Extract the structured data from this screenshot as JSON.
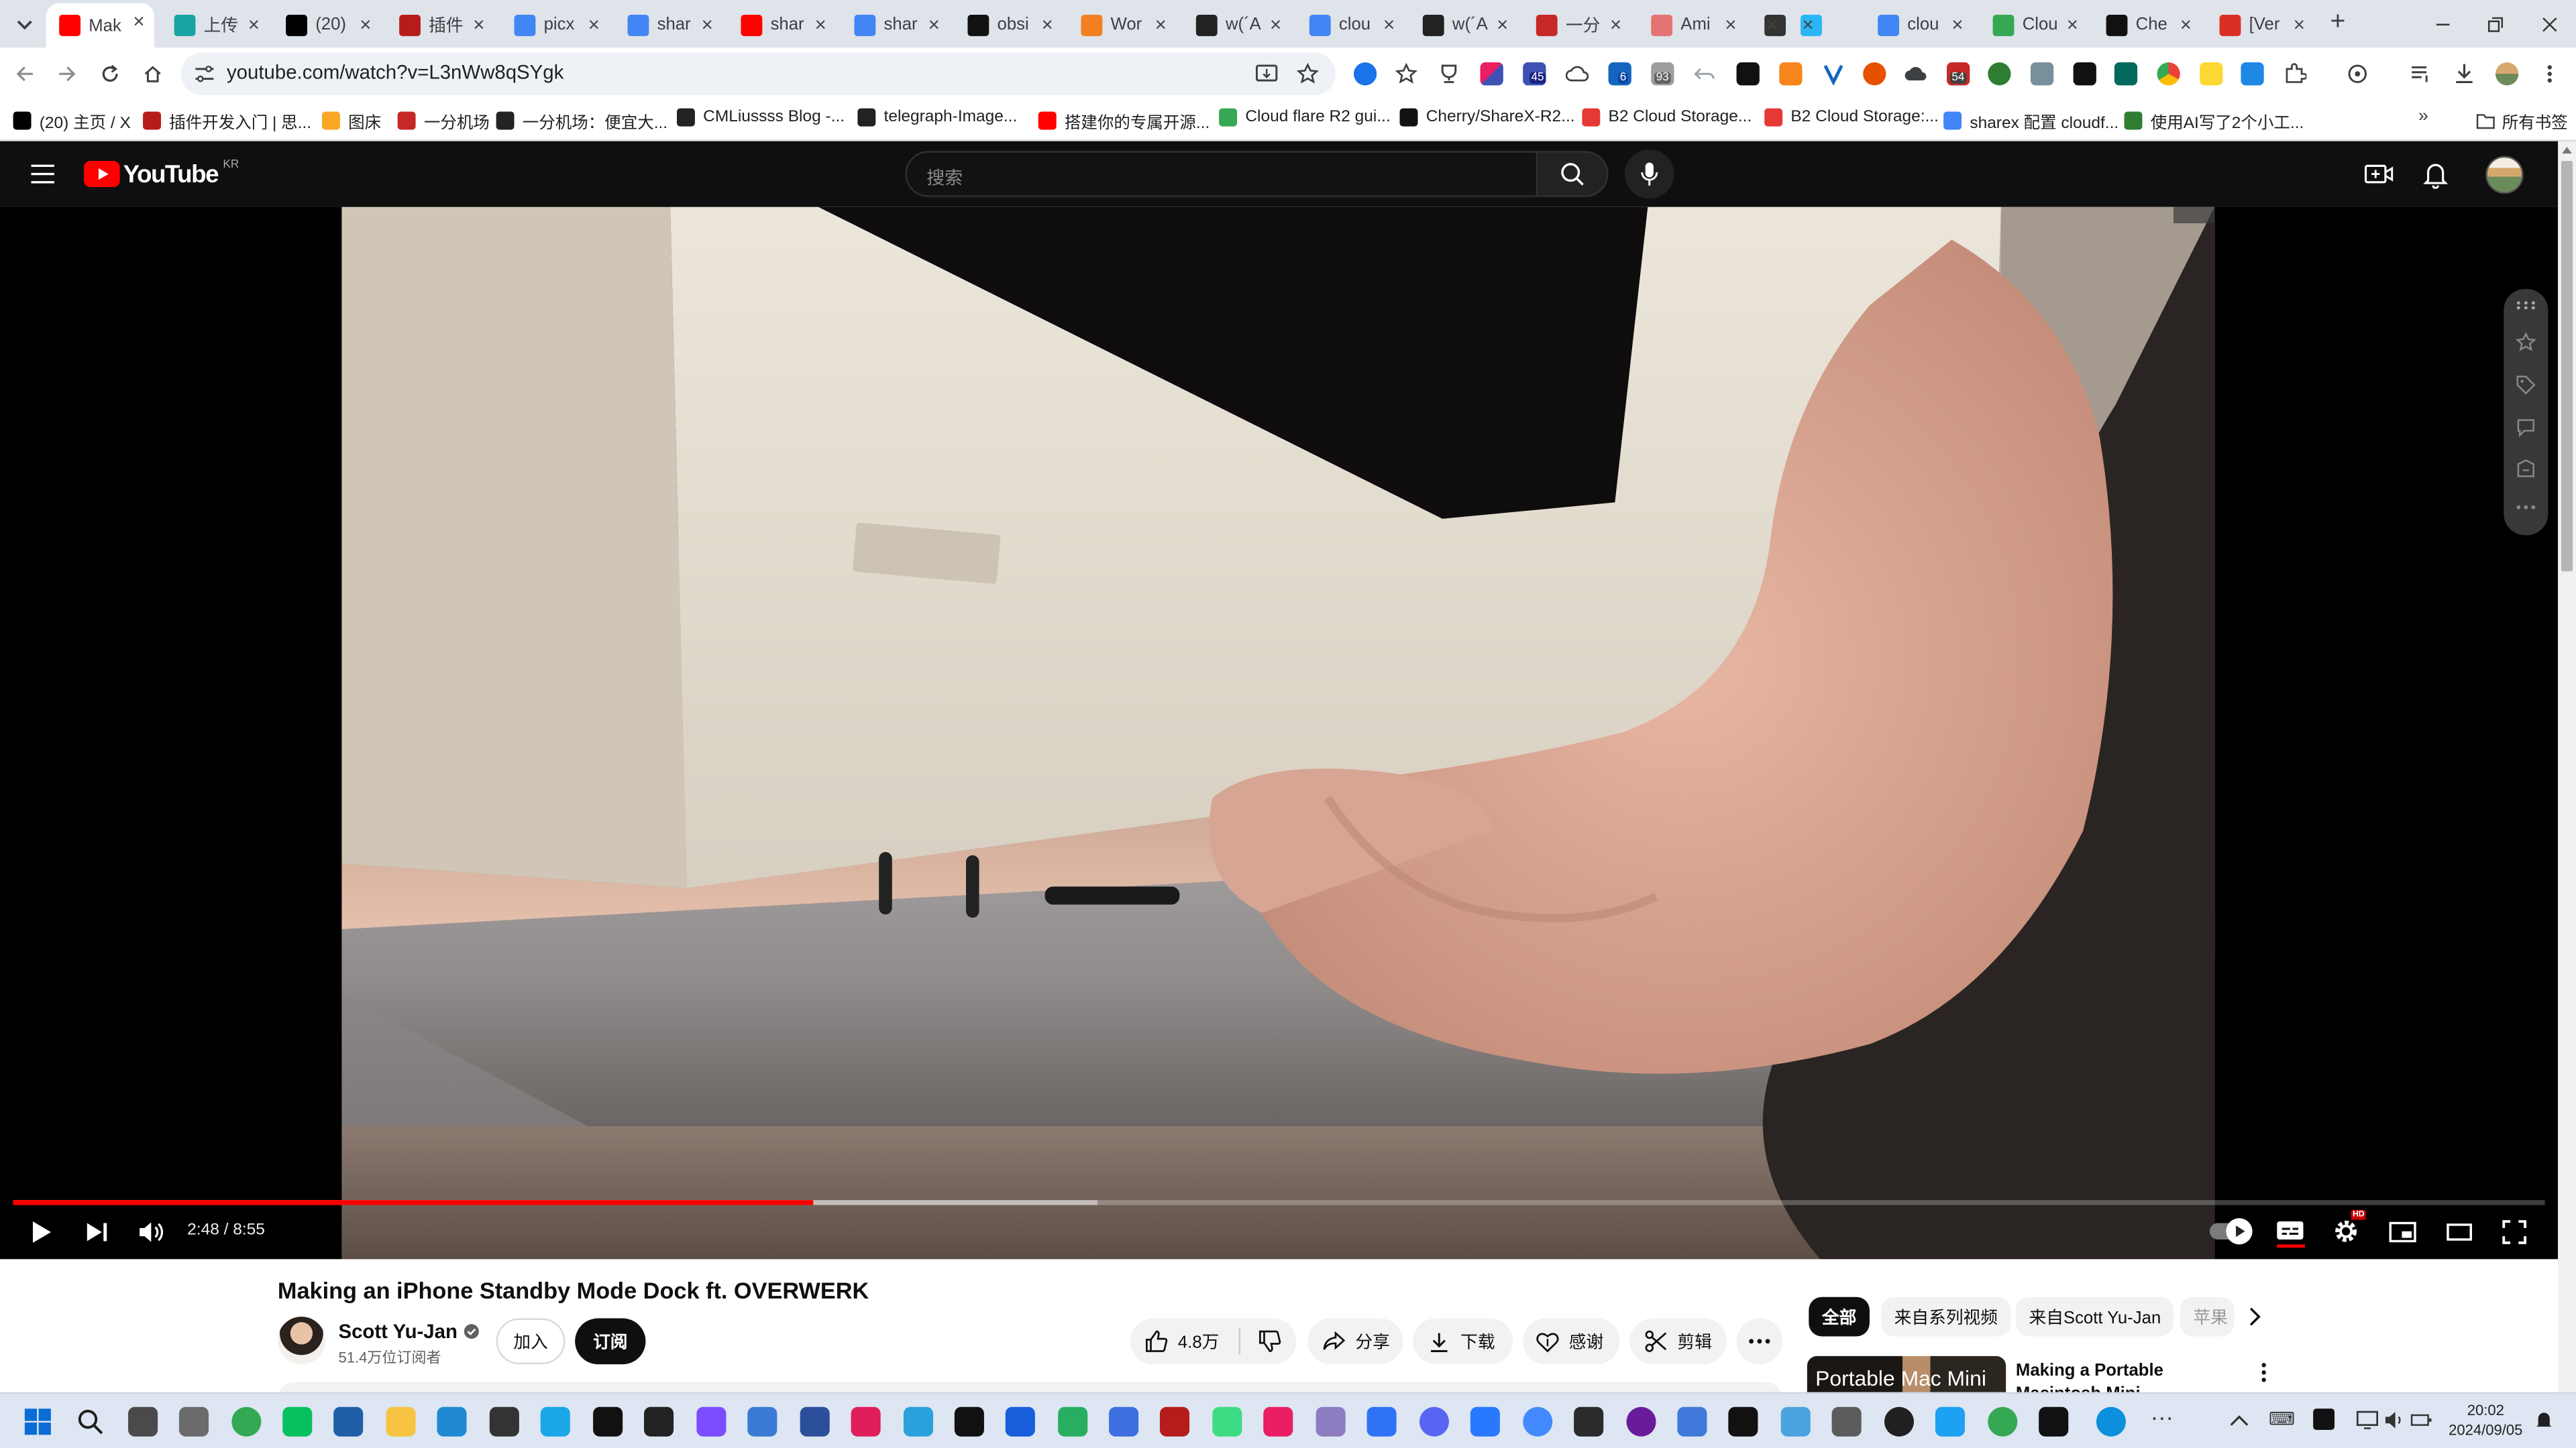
{
  "browser": {
    "tabs": [
      {
        "label": "Mak",
        "icon": "youtube-icon",
        "color": "#ff0000",
        "active": true
      },
      {
        "label": "上传",
        "icon": "upload-site-icon",
        "color": "#1aa3a3"
      },
      {
        "label": "(20)",
        "icon": "x-icon",
        "color": "#000000"
      },
      {
        "label": "插件",
        "icon": "m-icon",
        "color": "#b71c1c"
      },
      {
        "label": "picx",
        "icon": "google-icon",
        "color": "#4285f4"
      },
      {
        "label": "shar",
        "icon": "google-icon",
        "color": "#4285f4"
      },
      {
        "label": "shar",
        "icon": "youtube-icon",
        "color": "#ff0000"
      },
      {
        "label": "shar",
        "icon": "google-icon",
        "color": "#4285f4"
      },
      {
        "label": "obsi",
        "icon": "github-icon",
        "color": "#111111"
      },
      {
        "label": "Wor",
        "icon": "cloudflare-icon",
        "color": "#f38020"
      },
      {
        "label": "w(´A",
        "icon": "cm-icon",
        "color": "#222222"
      },
      {
        "label": "clou",
        "icon": "google-icon",
        "color": "#4285f4"
      },
      {
        "label": "w(´A",
        "icon": "cm-icon",
        "color": "#222222"
      },
      {
        "label": "一分",
        "icon": "site-icon",
        "color": "#c62828"
      },
      {
        "label": "Ami",
        "icon": "ami-icon",
        "color": "#e57373"
      },
      {
        "label": "",
        "icon": "grid-icon",
        "color": "#333333"
      },
      {
        "label": "",
        "icon": "drop-icon",
        "color": "#29b6f6"
      },
      {
        "label": "clou",
        "icon": "google-icon",
        "color": "#4285f4"
      },
      {
        "label": "Clou",
        "icon": "chrome-icon",
        "color": "#34a853"
      },
      {
        "label": "Che",
        "icon": "github-icon",
        "color": "#111111"
      },
      {
        "label": "[Ver",
        "icon": "gmail-icon",
        "color": "#d93025"
      }
    ],
    "address": {
      "url": "youtube.com/watch?v=L3nWw8qSYgk"
    },
    "badges": {
      "b1": "45",
      "b2": "6",
      "b3": "93",
      "b4": "54"
    },
    "bookmarks": [
      {
        "label": "(20) 主页 / X",
        "color": "#000000"
      },
      {
        "label": "插件开发入门 | 思...",
        "color": "#b71c1c"
      },
      {
        "label": "图床",
        "color": "#f9a825"
      },
      {
        "label": "一分机场",
        "color": "#c62828"
      },
      {
        "label": "一分机场：便宜大...",
        "color": "#222222"
      },
      {
        "label": "CMLiussss Blog -...",
        "color": "#222222"
      },
      {
        "label": "telegraph-Image...",
        "color": "#222222"
      },
      {
        "label": "搭建你的专属开源...",
        "color": "#ff0000"
      },
      {
        "label": "Cloud flare R2 gui...",
        "color": "#34a853"
      },
      {
        "label": "Cherry/ShareX-R2...",
        "color": "#111111"
      },
      {
        "label": "B2 Cloud Storage...",
        "color": "#e53935"
      },
      {
        "label": "B2 Cloud Storage:...",
        "color": "#e53935"
      },
      {
        "label": "sharex 配置 cloudf...",
        "color": "#4285f4"
      },
      {
        "label": "使用AI写了2个小工...",
        "color": "#2e7d32"
      }
    ],
    "all_bookmarks": "所有书签"
  },
  "youtube": {
    "logo_text": "YouTube",
    "region": "KR",
    "search_placeholder": "搜索",
    "player": {
      "time": "2:48 / 8:55",
      "progress": 0.316,
      "buffered": 0.428,
      "hd": "HD"
    },
    "video": {
      "title": "Making an iPhone Standby Mode Dock ft. OVERWERK",
      "channel": "Scott Yu-Jan",
      "subscribers": "51.4万位订阅者",
      "join": "加入",
      "subscribe": "订阅",
      "likes": "4.8万",
      "share": "分享",
      "download": "下载",
      "thanks": "感谢",
      "clip": "剪辑"
    },
    "chips": [
      "全部",
      "来自系列视频",
      "来自Scott Yu-Jan",
      "苹果"
    ],
    "recommend": {
      "title": "Making a Portable Macintosh Mini",
      "thumb_text": "Portable Mac Mini"
    }
  },
  "taskbar": {
    "time": "20:02",
    "date": "2024/09/05"
  }
}
